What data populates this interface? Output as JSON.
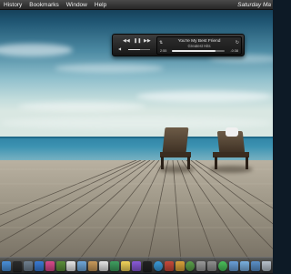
{
  "menubar": {
    "items": [
      "History",
      "Bookmarks",
      "Window",
      "Help"
    ],
    "clock": "Saturday  Ma"
  },
  "player": {
    "song": "You're My Best Friend",
    "album": "Greatest Hits",
    "elapsed": "2:55",
    "remaining": "-0:38",
    "progress": 0.82,
    "volume": 0.55,
    "buttons": {
      "previous": "prev-icon",
      "play": "play-pause-icon",
      "next": "next-icon",
      "shuffle": "shuffle-icon",
      "repeat": "repeat-icon"
    }
  },
  "dock": {
    "icons": [
      "finder-icon",
      "dashboard-icon",
      "system-icon",
      "appstore-icon",
      "itunes-icon",
      "photos-icon",
      "calendar-icon",
      "mail-icon",
      "contacts-icon",
      "textedit-icon",
      "maps-icon",
      "notes-icon",
      "media-icon",
      "terminal-icon",
      "safari-icon",
      "tools-icon",
      "app-icon",
      "chrome-icon",
      "messages-icon",
      "preferences-icon",
      "facetime-icon",
      "folder-icon",
      "documents-icon",
      "downloads-icon",
      "trash-icon"
    ],
    "colors": [
      "#4a90d9",
      "#2b2b2b",
      "#6f7f8f",
      "#3a7bd5",
      "#d94a8c",
      "#5b8f3a",
      "#e8e8e8",
      "#6fa7d9",
      "#c99a5a",
      "#e6e6e6",
      "#3f9f5f",
      "#f2d45a",
      "#8a5ad9",
      "#222222",
      "#3a9ad9",
      "#c74a3a",
      "#d9a23a",
      "#5aa04a",
      "#9a9a9a",
      "#8f8f8f",
      "#4ac05a",
      "#6aa0d8",
      "#7ab0e0",
      "#5a90c8",
      "#b8c2cc"
    ]
  }
}
